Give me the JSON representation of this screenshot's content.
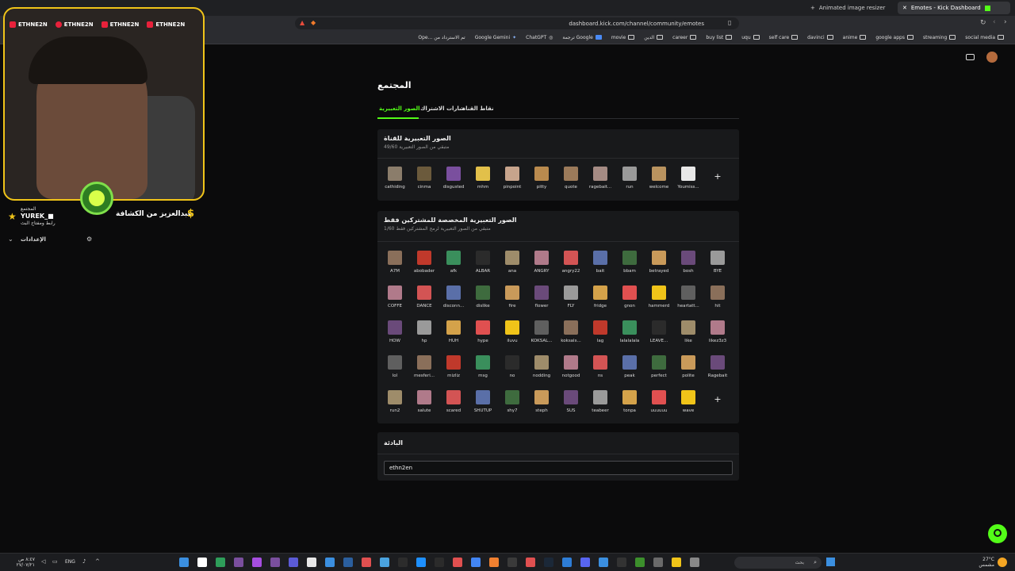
{
  "browser": {
    "tabs": [
      {
        "label": "Animated image resizer",
        "active": false
      },
      {
        "label": "Emotes - Kick Dashboard",
        "active": true
      }
    ],
    "url": "dashboard.kick.com/channel/community/emotes",
    "bookmarks": [
      "Ope... تم الاسترداد من",
      "Google Gemini",
      "ChatGPT",
      "ترجمة Google",
      "movie",
      "الدين",
      "career",
      "buy list",
      "uqu",
      "self care",
      "davinci",
      "anime",
      "google apps",
      "streaming",
      "social media"
    ]
  },
  "page": {
    "title": "المجتمع",
    "tabs": [
      {
        "label": "نقاط القناة",
        "active": false
      },
      {
        "label": "شارات الاشتراك",
        "active": false
      },
      {
        "label": "الصور التعبيرية",
        "active": true
      }
    ],
    "channel_emotes": {
      "title": "الصور التعبيرية للقناة",
      "subtitle": "49/60 متبقي من الصور التعبيرية",
      "add_label": "+"
    },
    "subscriber_emotes": {
      "title": "الصور التعبيرية المخصصة للمشتركين فقط",
      "subtitle": "1/60 متبقي من الصور التعبيرية لرمح المشتركين فقط",
      "add_label": "+"
    },
    "wallet": {
      "title": "البادئة",
      "value": "ethn2en"
    }
  },
  "channel_emote_names": [
    "cathiding",
    "cinma",
    "disgusted",
    "mhm",
    "pinpoint",
    "pitty",
    "quote",
    "ragebait...",
    "run",
    "welcome",
    "Youmiss..."
  ],
  "subscriber_emote_rows": [
    [
      "A7M",
      "abobader",
      "afk",
      "ALBAR",
      "ana",
      "ANGRY",
      "angry22",
      "bait",
      "bbam",
      "betrayed",
      "bosh",
      "BYE"
    ],
    [
      "COFFE",
      "DANCE",
      "disconn...",
      "dislike",
      "fire",
      "flower",
      "FLY",
      "fridge",
      "gnon",
      "hammerd",
      "heartatt...",
      "hit"
    ],
    [
      "HOW",
      "hp",
      "HUH",
      "hype",
      "iluvu",
      "KOKSAL...",
      "koksals...",
      "lag",
      "lalalalala",
      "LEAVE...",
      "like",
      "likez3z3"
    ],
    [
      "lol",
      "mesferi...",
      "mizliz",
      "msg",
      "no",
      "nodding",
      "notgood",
      "ns",
      "peak",
      "perfect",
      "polite",
      "Ragebait"
    ],
    [
      "run2",
      "salute",
      "scared",
      "SHUTUP",
      "shy7",
      "steph",
      "SUS",
      "teabeer",
      "tonpa",
      "uuuuuu",
      "wave"
    ]
  ],
  "overlay": {
    "socials": [
      "ETHNE2N",
      "ETHNE2N",
      "ETHNE2N",
      "ETHNE2N"
    ],
    "community_label": "المجتمع",
    "username": "YUREK_■",
    "sub_label": "رابط ومفتاح البث",
    "streamer_name": "عبدالعزيز من الكشافة",
    "settings_label": "الإعدادات"
  },
  "taskbar": {
    "search_placeholder": "بحث",
    "lang": "ENG",
    "time": "٨:٤٧ ص",
    "date": "٢٧/٠٧/٢١",
    "weather_temp": "27°C",
    "weather_desc": "مشمس"
  }
}
